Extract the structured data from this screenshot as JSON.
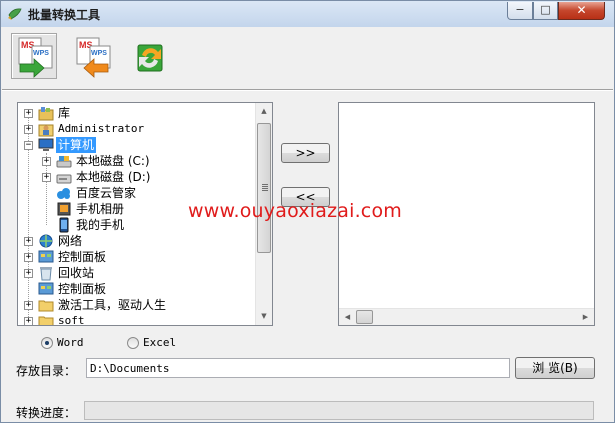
{
  "window": {
    "title": "批量转换工具",
    "controls": {
      "minimize": "−",
      "maximize": "□",
      "close": "✕"
    }
  },
  "toolbar": [
    {
      "icon": "ms-to-wps-icon"
    },
    {
      "icon": "wps-to-ms-icon"
    },
    {
      "icon": "refresh-convert-icon"
    }
  ],
  "tree": {
    "items": [
      {
        "label": "库",
        "icon": "library-icon"
      },
      {
        "label": "Administrator",
        "icon": "user-folder-icon"
      },
      {
        "label": "计算机",
        "icon": "computer-icon",
        "selected": true
      },
      {
        "label": "本地磁盘 (C:)",
        "icon": "drive-icon"
      },
      {
        "label": "本地磁盘 (D:)",
        "icon": "drive-icon"
      },
      {
        "label": "百度云管家",
        "icon": "cloud-icon"
      },
      {
        "label": "手机相册",
        "icon": "phone-album-icon"
      },
      {
        "label": "我的手机",
        "icon": "phone-icon"
      },
      {
        "label": "网络",
        "icon": "network-icon"
      },
      {
        "label": "控制面板",
        "icon": "control-panel-icon"
      },
      {
        "label": "回收站",
        "icon": "recycle-bin-icon"
      },
      {
        "label": "控制面板",
        "icon": "control-panel-icon"
      },
      {
        "label": "激活工具，驱动人生",
        "icon": "folder-icon"
      },
      {
        "label": "soft",
        "icon": "folder-icon"
      }
    ]
  },
  "transfer": {
    "add_label": ">>",
    "remove_label": "<<"
  },
  "format": {
    "options": [
      "Word",
      "Excel"
    ],
    "selected": "Word"
  },
  "save_dir": {
    "label": "存放目录：",
    "value": "D:\\Documents",
    "browse_label": "浏 览(B)"
  },
  "progress": {
    "label": "转换进度：",
    "value": 0
  },
  "watermark": "www.ouyaoxiazai.com"
}
